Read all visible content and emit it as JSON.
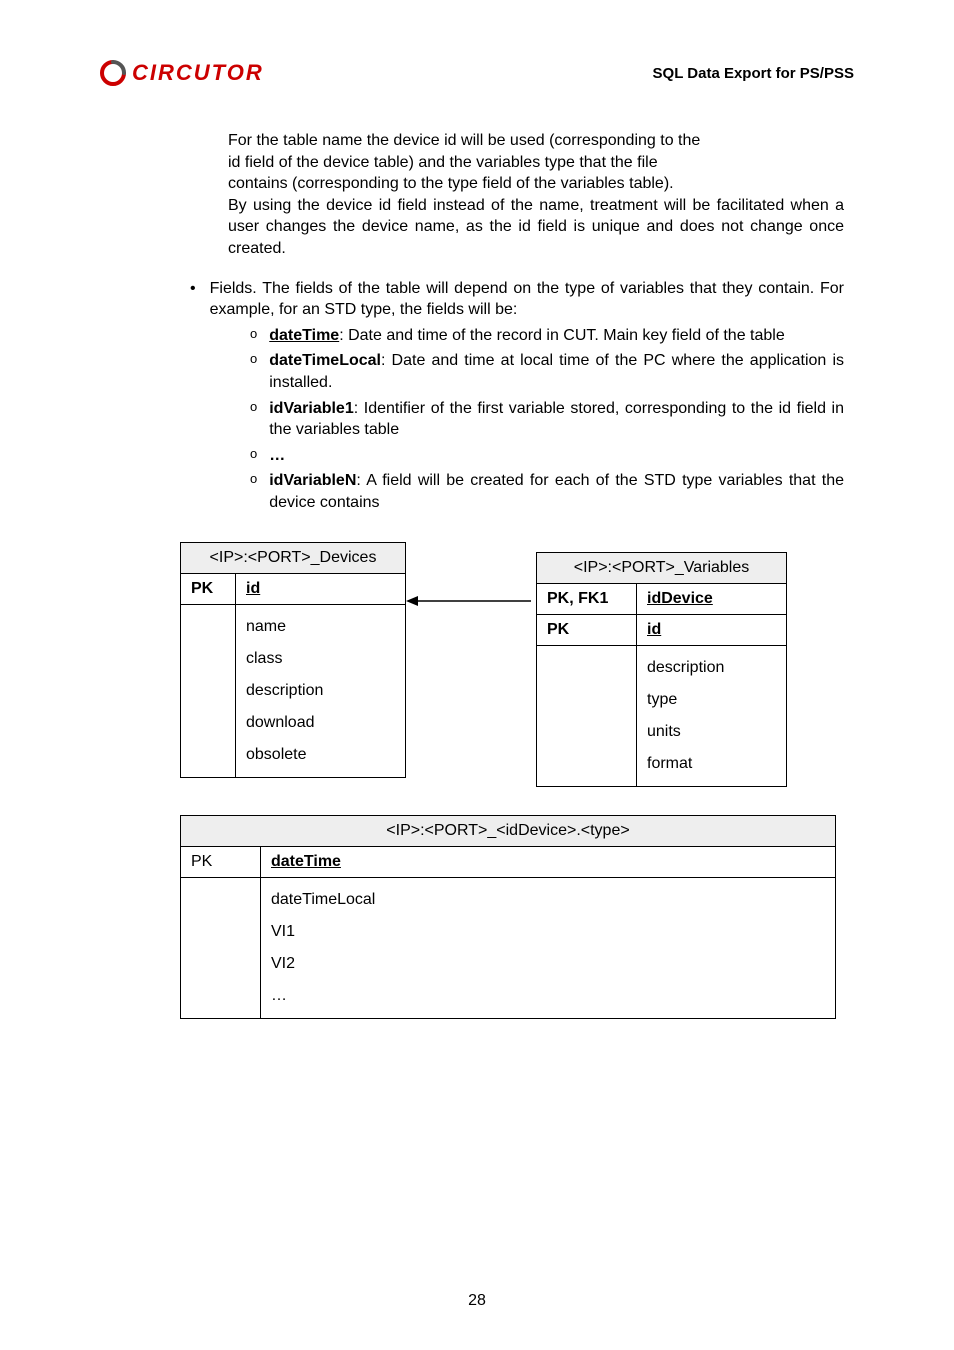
{
  "header": {
    "brand": "CIRCUTOR",
    "doc_title": "SQL Data Export for PS/PSS"
  },
  "para1_l1": "For the table name the device id will be used (corresponding to the",
  "para1_l2": "id field of the device table) and the variables type that the file",
  "para1_l3": "contains (corresponding to the type field of the variables table).",
  "para1_l4": "By using the device id field instead of the name, treatment will be facilitated when a user changes the device name, as the id field is unique and does not change once created.",
  "bullet_fields": "Fields. The fields of the table will depend on the type of variables that they contain. For example, for an STD type, the fields will be:",
  "sub1_key": "dateTime",
  "sub1_rest": ": Date and time of the record in CUT. Main key field of the table",
  "sub2_key": "dateTimeLocal",
  "sub2_rest": ": Date and time at local time of the PC where the application is installed.",
  "sub3_key": "idVariable1",
  "sub3_rest": ": Identifier of the first variable stored, corresponding to the id field in the variables table",
  "sub4_key": "…",
  "sub5_key": "idVariableN",
  "sub5_rest": ": A field will be created for each of the STD type variables that the device contains",
  "devices_table": {
    "caption": "<IP>:<PORT>_Devices",
    "pk": "PK",
    "id": "id",
    "rows": [
      "name",
      "class",
      "description",
      "download",
      "obsolete"
    ]
  },
  "variables_table": {
    "caption": "<IP>:<PORT>_Variables",
    "pkfk": "PK, FK1",
    "pk": "PK",
    "iddevice": "idDevice",
    "id": "id",
    "rows": [
      "description",
      "type",
      "units",
      "format"
    ]
  },
  "detail_table": {
    "caption": "<IP>:<PORT>_<idDevice>.<type>",
    "pk": "PK",
    "dt": "dateTime",
    "rows": [
      "dateTimeLocal",
      "VI1",
      "VI2",
      "…"
    ]
  },
  "page_number": "28",
  "chart_data": {
    "type": "table",
    "tables": [
      {
        "name": "<IP>:<PORT>_Devices",
        "columns": [
          "key",
          "field"
        ],
        "rows": [
          [
            "PK",
            "id"
          ],
          [
            "",
            "name"
          ],
          [
            "",
            "class"
          ],
          [
            "",
            "description"
          ],
          [
            "",
            "download"
          ],
          [
            "",
            "obsolete"
          ]
        ]
      },
      {
        "name": "<IP>:<PORT>_Variables",
        "columns": [
          "key",
          "field"
        ],
        "rows": [
          [
            "PK, FK1",
            "idDevice"
          ],
          [
            "PK",
            "id"
          ],
          [
            "",
            "description"
          ],
          [
            "",
            "type"
          ],
          [
            "",
            "units"
          ],
          [
            "",
            "format"
          ]
        ]
      },
      {
        "name": "<IP>:<PORT>_<idDevice>.<type>",
        "columns": [
          "key",
          "field"
        ],
        "rows": [
          [
            "PK",
            "dateTime"
          ],
          [
            "",
            "dateTimeLocal"
          ],
          [
            "",
            "VI1"
          ],
          [
            "",
            "VI2"
          ],
          [
            "",
            "…"
          ]
        ]
      }
    ],
    "relations": [
      {
        "from_table": "<IP>:<PORT>_Variables",
        "from_field": "idDevice",
        "to_table": "<IP>:<PORT>_Devices",
        "to_field": "id"
      }
    ]
  }
}
